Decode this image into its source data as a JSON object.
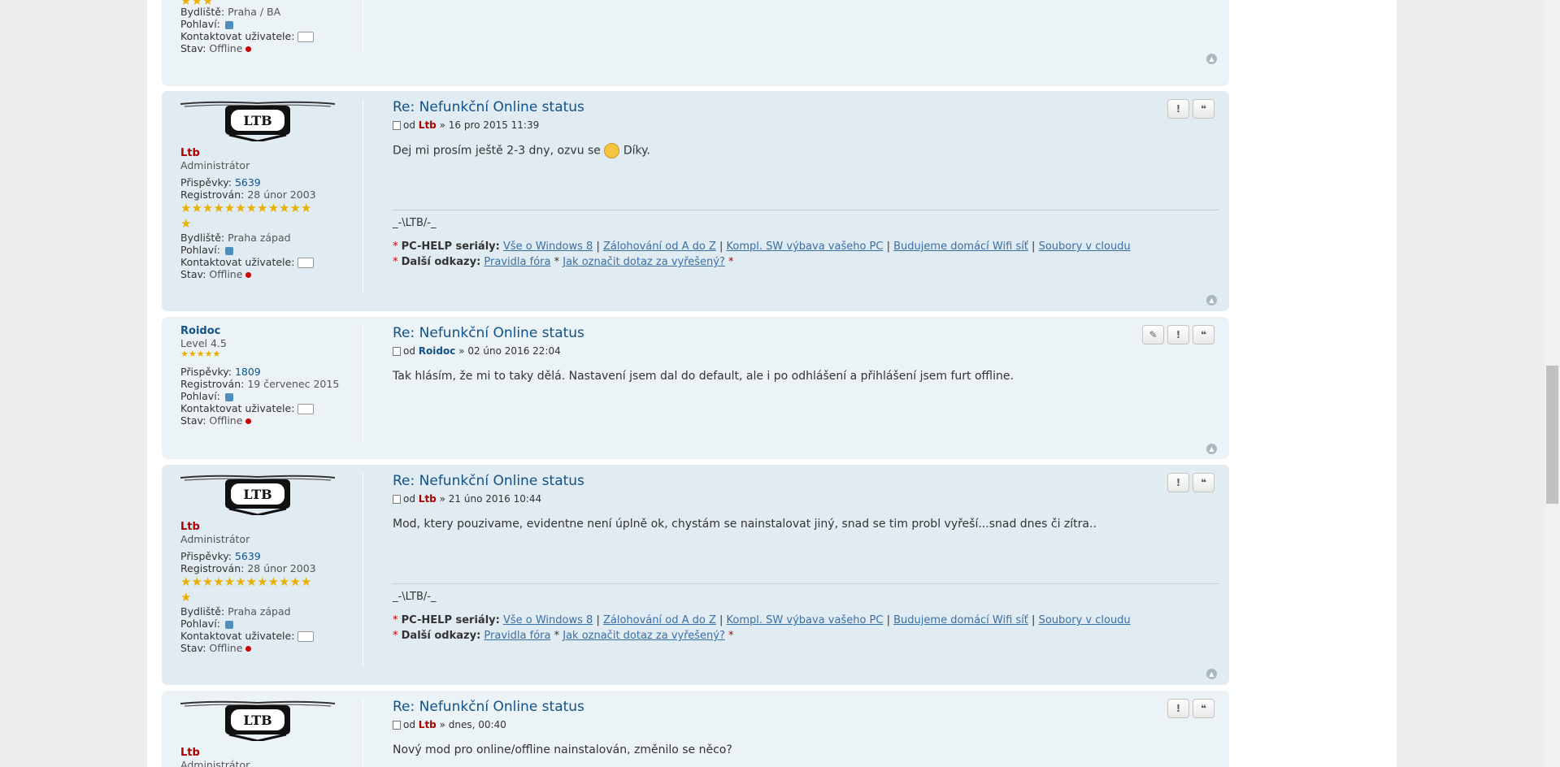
{
  "topic_title": "Re: Nefunkční Online status",
  "labels": {
    "from": "od",
    "sep": "»",
    "posts": "Přispěvky:",
    "registered": "Registrován:",
    "residence": "Bydliště:",
    "gender": "Pohlaví:",
    "contact": "Kontaktovat uživatele:",
    "status": "Stav:",
    "offline": "Offline"
  },
  "post0": {
    "stars": "★★★",
    "residence": "Praha / BA"
  },
  "admin": {
    "name": "Ltb",
    "rank": "Administrátor",
    "posts": "5639",
    "registered": "28 únor 2003",
    "stars_row1": "★★★★★★★★★★★★",
    "stars_row2": "★",
    "residence": "Praha západ"
  },
  "roidoc": {
    "name": "Roidoc",
    "rank": "Level 4.5",
    "stars": "★★★★★",
    "posts": "1809",
    "registered": "19 červenec 2015"
  },
  "posts": [
    {
      "date": "16 pro 2015 11:39",
      "content_before": "Dej mi prosím ještě 2-3 dny, ozvu se",
      "content_after": "Díky."
    },
    {
      "date": "02 úno 2016 22:04",
      "content": "Tak hlásím, že mi to taky dělá. Nastavení jsem dal do default, ale i po odhlášení a přihlášení jsem furt offline."
    },
    {
      "date": "21 úno 2016 10:44",
      "content": "Mod, ktery pouzivame, evidentne není úplně ok, chystám se nainstalovat jiný, snad se tim probl vyřeší...snad dnes či zítra.."
    },
    {
      "date": "dnes, 00:40",
      "content": "Nový mod pro online/offline nainstalován, změnilo se něco?"
    }
  ],
  "signature": {
    "name_line": "_-\\LTB/-_",
    "row1_label": "PC-HELP seriály:",
    "row1_links": [
      "Vše o Windows 8",
      "Zálohování od A do Z",
      "Kompl. SW výbava vašeho PC",
      "Budujeme domácí Wifi síť",
      "Soubory v cloudu"
    ],
    "row2_label": "Další odkazy:",
    "row2_links": [
      "Pravidla fóra",
      "Jak označit dotaz za vyřešený?"
    ],
    "bullet": "*",
    "pipe": "|"
  },
  "buttons": {
    "edit": "✎",
    "report": "!",
    "quote": "❝",
    "top": "▲"
  },
  "colors": {
    "admin": "#aa0000",
    "member": "#105289",
    "post_bg_light": "#ecf3f7",
    "post_bg_dark": "#e1ebf2"
  },
  "icons": [
    "post-icon",
    "contact-icon",
    "gender-icon",
    "offline-dot",
    "edit-icon",
    "report-icon",
    "quote-icon",
    "back-to-top-icon"
  ]
}
